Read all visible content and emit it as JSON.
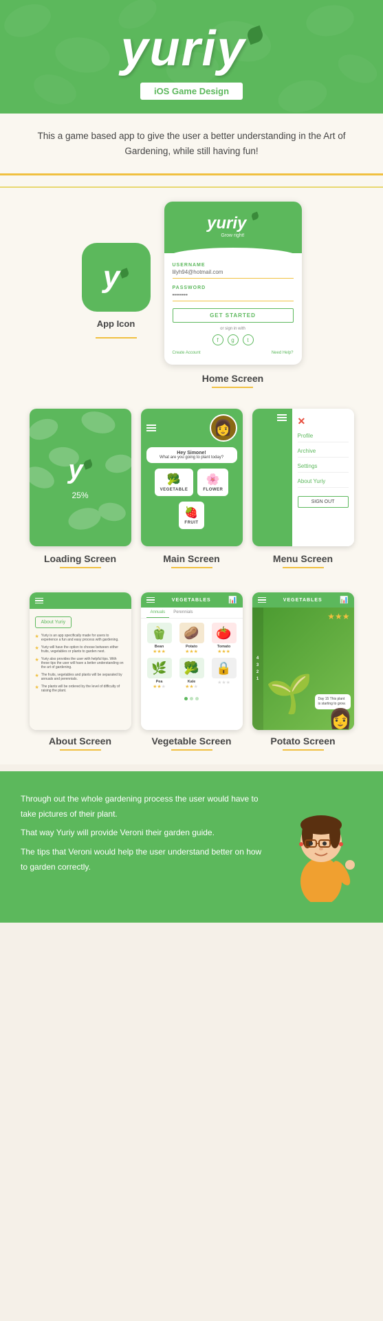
{
  "header": {
    "logo": "yuriy",
    "subtitle": "iOS Game Design"
  },
  "description": {
    "text": "This a game based app to give the user a better understanding in the Art of Gardening, while still having fun!"
  },
  "app_icon": {
    "label": "App Icon",
    "letter": "y"
  },
  "home_screen": {
    "label": "Home Screen",
    "logo": "yuriy",
    "tagline": "Grow right!",
    "username_label": "USERNAME",
    "username_value": "lilyh94@hotmail.com",
    "password_label": "PASSWORD",
    "password_value": "••••••••",
    "cta_button": "GET STARTED",
    "or_text": "or sign in with",
    "create_account": "Create Account",
    "need_help": "Need Help?"
  },
  "loading_screen": {
    "label": "Loading Screen",
    "logo": "y",
    "percent": "25%"
  },
  "main_screen": {
    "label": "Main Screen",
    "greeting": "Hey Simone!",
    "question": "What are you going to plant today?",
    "options": [
      {
        "icon": "🥦",
        "name": "VEGETABLE"
      },
      {
        "icon": "🌸",
        "name": "FLOWER"
      },
      {
        "icon": "🍓",
        "name": "FRUIT"
      }
    ]
  },
  "menu_screen": {
    "label": "Menu Screen",
    "items": [
      "Profile",
      "Archive",
      "Settings",
      "About Yuriy"
    ],
    "sign_out": "SIGN OUT"
  },
  "about_screen": {
    "label": "About Screen",
    "button": "About Yuriy",
    "bullets": [
      "Yuriy is an app specifically made for users to experience a fun and easy process with gardening.",
      "Yuriy will have the option to choose between either fruits, vegetables or plants to garden next.",
      "Yuriy also provides the user with helpful tips. With these tips the user will have a better understanding on the art of gardening.",
      "The fruits, vegetables and plants will be separated by annuals and perennials.",
      "The plants will be ordered by the level of difficulty of raising the plant."
    ]
  },
  "vegetable_screen": {
    "label": "Vegetable Screen",
    "title": "VEGETABLES",
    "tabs": [
      "Annuals",
      "Perennials"
    ],
    "items": [
      {
        "icon": "🫑",
        "name": "Bean",
        "stars": 3
      },
      {
        "icon": "🥔",
        "name": "Potato",
        "stars": 3
      },
      {
        "icon": "🍅",
        "name": "Tomato",
        "stars": 3
      },
      {
        "icon": "🌿",
        "name": "Pea",
        "stars": 2
      },
      {
        "icon": "🥦",
        "name": "Kale",
        "stars": 2
      },
      {
        "icon": "🔒",
        "name": "Locked",
        "stars": 0
      }
    ]
  },
  "potato_screen": {
    "label": "Potato Screen",
    "title": "VEGETABLES",
    "sidebar_nums": [
      "4",
      "3",
      "2",
      "1"
    ],
    "stars": 3,
    "info_text": "Day 15 This plant is starting to grow."
  },
  "footer": {
    "text_lines": [
      "Through out the whole gardening process the user would have to take pictures of their plant.",
      "That way Yuriy will provide Veroni their garden guide.",
      "The tips that Veroni would  help the user understand better on how to garden correctly."
    ]
  }
}
